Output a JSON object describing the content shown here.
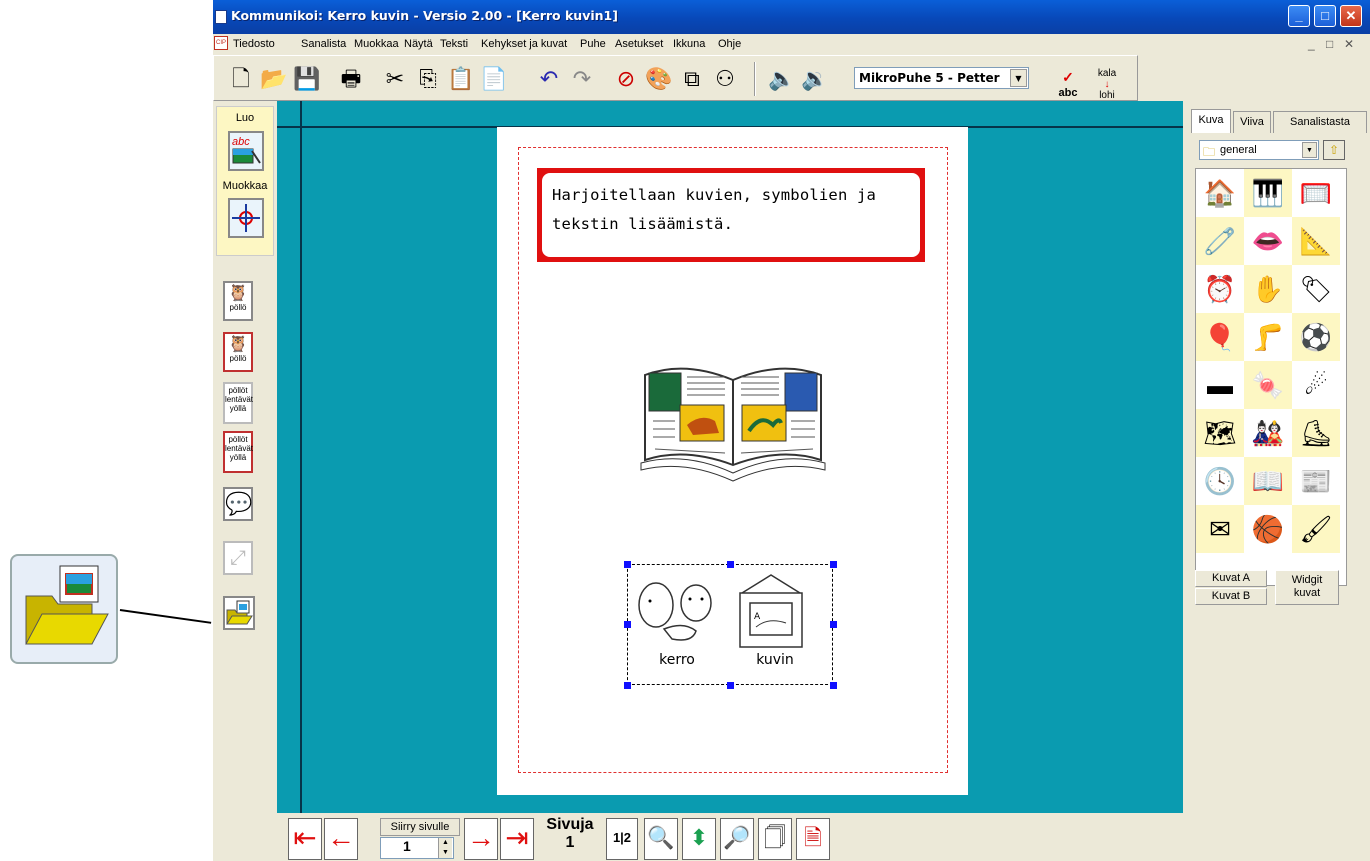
{
  "window": {
    "title": "Kommunikoi: Kerro kuvin - Versio 2.00 - [Kerro kuvin1]",
    "min": "_",
    "max": "□",
    "close": "✕"
  },
  "menu": {
    "items": [
      "Tiedosto",
      "Sanalista",
      "Muokkaa",
      "Näytä",
      "Teksti",
      "Kehykset ja kuvat",
      "Puhe",
      "Asetukset",
      "Ikkuna",
      "Ohje"
    ],
    "mdi": [
      "_",
      "□",
      "✕"
    ]
  },
  "toolbar": {
    "voice": "MikroPuhe 5 - Petter",
    "spell_label": "abc",
    "kala_top": "kala",
    "kala_bottom": "lohi"
  },
  "left_tools": {
    "luo": "Luo",
    "muokkaa": "Muokkaa",
    "pollo1": "pöllö",
    "pollo2": "pöllö",
    "pollot1": "pöllöt lentävät yöllä",
    "pollot2": "pöllöt lentävät yöllä"
  },
  "document": {
    "text": "Harjoitellaan kuvien, symbolien ja tekstin lisäämistä.",
    "symbol1": "kerro",
    "symbol2": "kuvin"
  },
  "right_panel": {
    "tabs": [
      "Kuva",
      "Viiva",
      "Sanalistasta"
    ],
    "folder": "general",
    "kuvat_a": "Kuvat A",
    "kuvat_b": "Kuvat B",
    "widgit": "Widgit kuvat"
  },
  "navbar": {
    "siirry": "Siirry sivulle",
    "page_value": "1",
    "sivuja_label": "Sivuja",
    "sivuja_count": "1",
    "pages_icon": "1|2"
  },
  "colors": {
    "titlebar": "#0848b8",
    "canvas": "#0a9bb0",
    "textbox_border": "#e01010",
    "handle": "#1010ff"
  }
}
